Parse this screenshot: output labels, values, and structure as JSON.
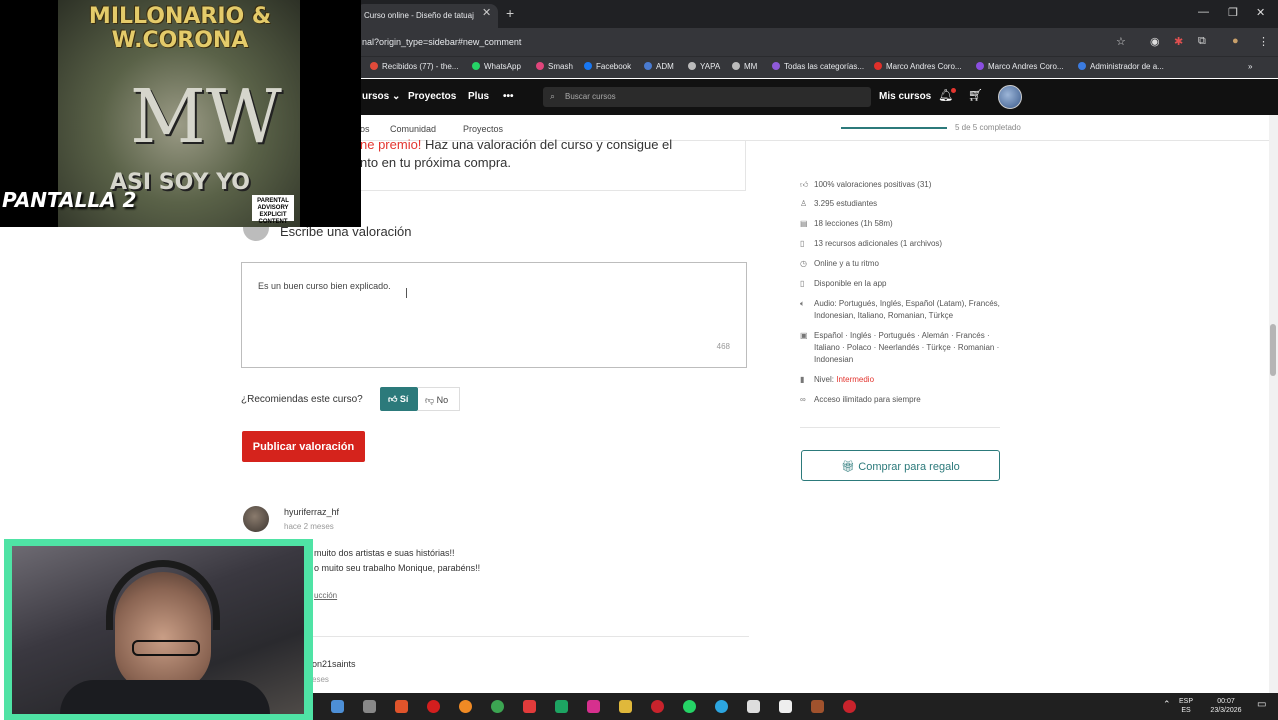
{
  "browser": {
    "tab_title": "Curso online - Diseño de tatuaj",
    "url": "nal?origin_type=sidebar#new_comment",
    "bookmarks": [
      "Recibidos (77) - the...",
      "WhatsApp",
      "Smash",
      "Facebook",
      "ADM",
      "YAPA",
      "MM",
      "Todas las categorías...",
      "Marco Andres Coro...",
      "Marco Andres Coro...",
      "Administrador de a..."
    ]
  },
  "nav": {
    "cursos": "ursos",
    "proyectos": "Proyectos",
    "plus": "Plus",
    "more": "•••",
    "search_placeholder": "Buscar cursos",
    "mis_cursos": "Mis cursos"
  },
  "subnav": {
    "item1": "os",
    "comunidad": "Comunidad",
    "proyectos": "Proyectos",
    "progress_text": "5 de 5 completado",
    "progress_fraction": 1.0
  },
  "promo": {
    "red": "ne premio!",
    "line1_rest": " Haz una valoración del curso y consigue el",
    "line2": "nto en tu próxima compra."
  },
  "review_form": {
    "heading": "Escribe una valoración",
    "text": "Es un buen curso bien explicado.",
    "char_count": "468",
    "recommend_question": "¿Recomiendas este curso?",
    "yes": "Sí",
    "no": "No",
    "publish": "Publicar valoración"
  },
  "comments": [
    {
      "user": "hyuriferraz_hf",
      "time": "hace 2 meses",
      "line1": "muito dos artistas e suas histórias!!",
      "line2": "o muito seu trabalho Monique, parabéns!!",
      "link": "ucción"
    },
    {
      "user": "on21saints",
      "time": "eses"
    }
  ],
  "sidebar": {
    "items": [
      {
        "icon": "thumbs-up-icon",
        "text": "100% valoraciones positivas (31)"
      },
      {
        "icon": "user-icon",
        "text": "3.295 estudiantes"
      },
      {
        "icon": "film-icon",
        "text": "18 lecciones (1h 58m)"
      },
      {
        "icon": "file-icon",
        "text": "13 recursos adicionales (1 archivos)"
      },
      {
        "icon": "clock-icon",
        "text": "Online y a tu ritmo"
      },
      {
        "icon": "phone-icon",
        "text": "Disponible en la app"
      },
      {
        "icon": "speaker-icon",
        "text": "Audio: Portugués, Inglés, Español (Latam), Francés, Indonesian, Italiano, Romanian, Türkçe"
      },
      {
        "icon": "subtitles-icon",
        "text": "Español · Inglés · Portugués · Alemán · Francés · Italiano · Polaco · Neerlandés · Türkçe · Romanian · Indonesian"
      },
      {
        "icon": "level-icon",
        "text": "Nivel: ",
        "highlight": "Intermedio"
      },
      {
        "icon": "infinity-icon",
        "text": "Acceso ilimitado para siempre"
      }
    ],
    "gift_button": "Comprar para regalo"
  },
  "overlay": {
    "album_title": "MILLONARIO & W.CORONA",
    "album_monogram": "MW",
    "album_bottom": "ASI SOY YO",
    "advisory": "PARENTAL ADVISORY EXPLICIT CONTENT",
    "screen_label": "PANTALLA 2"
  },
  "taskbar": {
    "lang_top": "ESP",
    "lang_bottom": "ES",
    "time": "00:07",
    "date": "23/3/2026"
  },
  "colors": {
    "accent_teal": "#2c7a7b",
    "brand_red": "#d5231c",
    "nav_bg": "#111111"
  }
}
